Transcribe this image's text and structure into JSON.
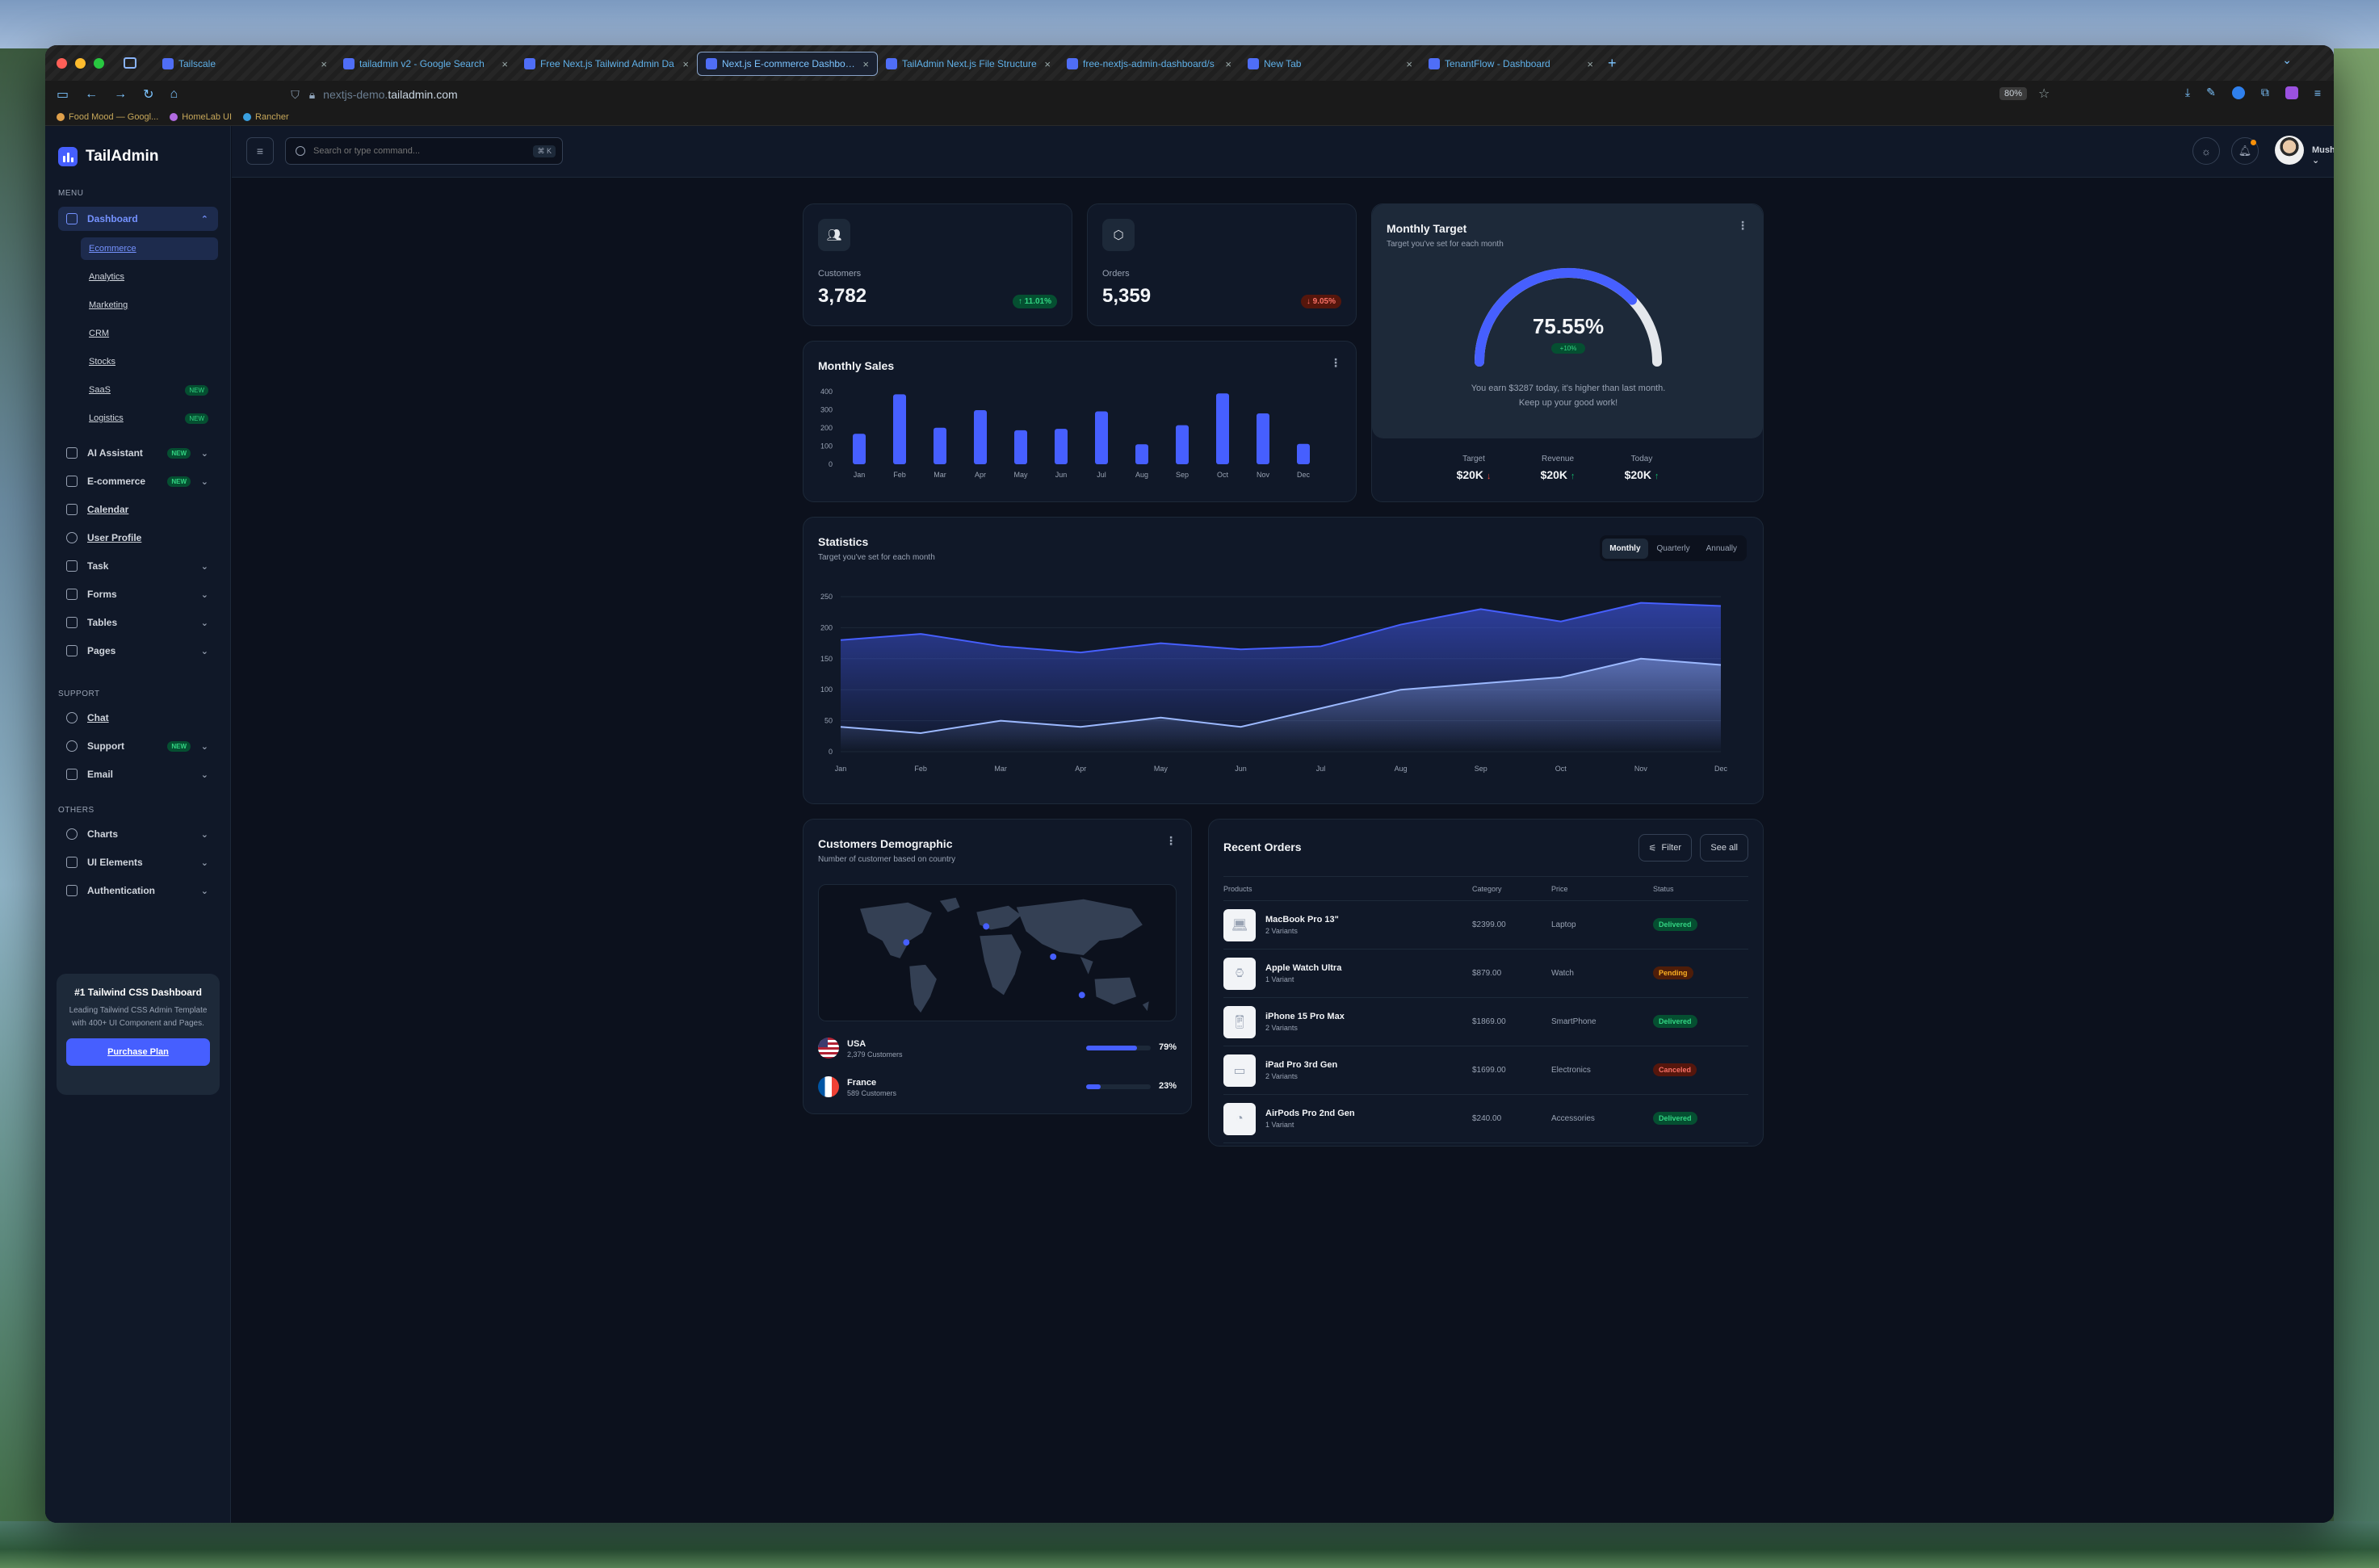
{
  "browser": {
    "tabs": [
      {
        "title": "Tailscale",
        "active": false
      },
      {
        "title": "tailadmin v2 - Google Search",
        "active": false
      },
      {
        "title": "Free Next.js Tailwind Admin Da",
        "active": false
      },
      {
        "title": "Next.js E-commerce Dashboard",
        "active": true
      },
      {
        "title": "TailAdmin Next.js File Structure",
        "active": false
      },
      {
        "title": "free-nextjs-admin-dashboard/s",
        "active": false
      },
      {
        "title": "New Tab",
        "active": false
      },
      {
        "title": "TenantFlow - Dashboard",
        "active": false
      }
    ],
    "url_sub": "nextjs-demo.",
    "url_host": "tailadmin.com",
    "zoom": "80%",
    "bookmarks": [
      "Food Mood — Googl...",
      "HomeLab UI",
      "Rancher"
    ]
  },
  "sidebar": {
    "brand": "TailAdmin",
    "menu_heading": "MENU",
    "support_heading": "SUPPORT",
    "others_heading": "OTHERS",
    "dashboard": "Dashboard",
    "subitems": [
      {
        "label": "Ecommerce",
        "badge": ""
      },
      {
        "label": "Analytics",
        "badge": ""
      },
      {
        "label": "Marketing",
        "badge": ""
      },
      {
        "label": "CRM",
        "badge": ""
      },
      {
        "label": "Stocks",
        "badge": ""
      },
      {
        "label": "SaaS",
        "badge": "NEW"
      },
      {
        "label": "Logistics",
        "badge": "NEW"
      }
    ],
    "items": {
      "ai": "AI Assistant",
      "ecommerce": "E-commerce",
      "calendar": "Calendar",
      "profile": "User Profile",
      "task": "Task",
      "forms": "Forms",
      "tables": "Tables",
      "pages": "Pages",
      "chat": "Chat",
      "support": "Support",
      "email": "Email",
      "charts": "Charts",
      "ui": "UI Elements",
      "auth": "Authentication"
    },
    "new_badge": "NEW",
    "promo": {
      "title": "#1 Tailwind CSS Dashboard",
      "text": "Leading Tailwind CSS Admin Template with 400+ UI Component and Pages.",
      "button": "Purchase Plan"
    }
  },
  "header": {
    "search_placeholder": "Search or type command...",
    "shortcut": "⌘ K",
    "user": "Musharof"
  },
  "metrics": {
    "customers": {
      "label": "Customers",
      "value": "3,782",
      "change": "↑ 11.01%"
    },
    "orders": {
      "label": "Orders",
      "value": "5,359",
      "change": "↓ 9.05%"
    }
  },
  "monthly_sales": {
    "title": "Monthly Sales"
  },
  "target": {
    "title": "Monthly Target",
    "subtitle": "Target you've set for each month",
    "percent": "75.55%",
    "percent_value": 75.55,
    "badge": "+10%",
    "message_line1": "You earn $3287 today, it's higher than last month.",
    "message_line2": "Keep up your good work!",
    "cols": [
      {
        "label": "Target",
        "value": "$20K",
        "dir": "down"
      },
      {
        "label": "Revenue",
        "value": "$20K",
        "dir": "up"
      },
      {
        "label": "Today",
        "value": "$20K",
        "dir": "up"
      }
    ]
  },
  "statistics": {
    "title": "Statistics",
    "subtitle": "Target you've set for each month",
    "tabs": [
      "Monthly",
      "Quarterly",
      "Annually"
    ],
    "active_tab": "Monthly"
  },
  "demographic": {
    "title": "Customers Demographic",
    "subtitle": "Number of customer based on country",
    "countries": [
      {
        "name": "USA",
        "customers": "2,379 Customers",
        "percent": "79%",
        "value": 79
      },
      {
        "name": "France",
        "customers": "589 Customers",
        "percent": "23%",
        "value": 23
      }
    ]
  },
  "orders": {
    "title": "Recent Orders",
    "filter": "Filter",
    "see_all": "See all",
    "columns": [
      "Products",
      "Category",
      "Price",
      "Status"
    ],
    "rows": [
      {
        "name": "MacBook Pro 13\"",
        "variants": "2 Variants",
        "price": "$2399.00",
        "category": "Laptop",
        "status": "Delivered"
      },
      {
        "name": "Apple Watch Ultra",
        "variants": "1 Variant",
        "price": "$879.00",
        "category": "Watch",
        "status": "Pending"
      },
      {
        "name": "iPhone 15 Pro Max",
        "variants": "2 Variants",
        "price": "$1869.00",
        "category": "SmartPhone",
        "status": "Delivered"
      },
      {
        "name": "iPad Pro 3rd Gen",
        "variants": "2 Variants",
        "price": "$1699.00",
        "category": "Electronics",
        "status": "Canceled"
      },
      {
        "name": "AirPods Pro 2nd Gen",
        "variants": "1 Variant",
        "price": "$240.00",
        "category": "Accessories",
        "status": "Delivered"
      }
    ]
  },
  "chart_data": [
    {
      "type": "bar",
      "title": "Monthly Sales",
      "categories": [
        "Jan",
        "Feb",
        "Mar",
        "Apr",
        "May",
        "Jun",
        "Jul",
        "Aug",
        "Sep",
        "Oct",
        "Nov",
        "Dec"
      ],
      "values": [
        168,
        385,
        201,
        298,
        187,
        195,
        291,
        110,
        215,
        390,
        280,
        112
      ],
      "ylim": [
        0,
        400
      ],
      "yticks": [
        0,
        100,
        200,
        300,
        400
      ],
      "color": "#465fff"
    },
    {
      "type": "area",
      "title": "Statistics",
      "categories": [
        "Jan",
        "Feb",
        "Mar",
        "Apr",
        "May",
        "Jun",
        "Jul",
        "Aug",
        "Sep",
        "Oct",
        "Nov",
        "Dec"
      ],
      "ylim": [
        0,
        250
      ],
      "yticks": [
        0,
        50,
        100,
        150,
        200,
        250
      ],
      "series": [
        {
          "values": [
            180,
            190,
            170,
            160,
            175,
            165,
            170,
            205,
            230,
            210,
            240,
            235
          ],
          "color": "#465fff"
        },
        {
          "values": [
            40,
            30,
            50,
            40,
            55,
            40,
            70,
            100,
            110,
            120,
            150,
            140
          ],
          "color": "#9cb9ff"
        }
      ]
    }
  ]
}
